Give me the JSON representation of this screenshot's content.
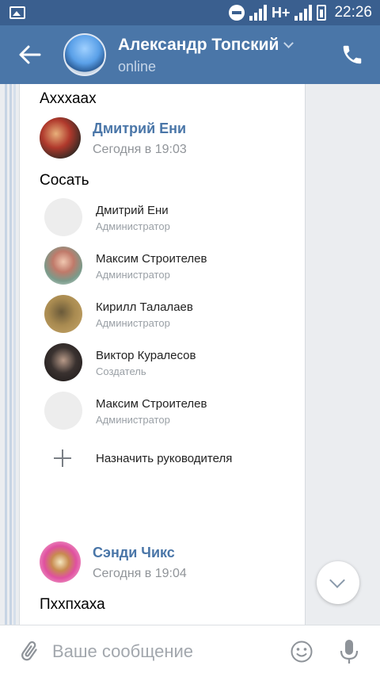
{
  "status_bar": {
    "network": "H+",
    "time": "22:26"
  },
  "header": {
    "title": "Александр Топский",
    "status": "online"
  },
  "messages": {
    "prev_text": "Ахххаах",
    "m1": {
      "sender": "Дмитрий Ени",
      "time": "Сегодня в 19:03",
      "text": "Сосать"
    },
    "m2": {
      "sender": "Сэнди Чикс",
      "time": "Сегодня в 19:04",
      "text": "Пхxпхаха"
    }
  },
  "members": [
    {
      "name": "Дмитрий Ени",
      "role": "Администратор"
    },
    {
      "name": "Максим Строителев",
      "role": "Администратор"
    },
    {
      "name": "Кирилл Талалаев",
      "role": "Администратор"
    },
    {
      "name": "Виктор Куралесов",
      "role": "Создатель"
    },
    {
      "name": "Максим Строителев",
      "role": "Администратор"
    }
  ],
  "appoint_label": "Назначить руководителя",
  "composer": {
    "placeholder": "Ваше сообщение"
  },
  "colors": {
    "header": "#4a76a8",
    "status_bar": "#3a5f8f",
    "accent_name": "#4a76a8"
  }
}
